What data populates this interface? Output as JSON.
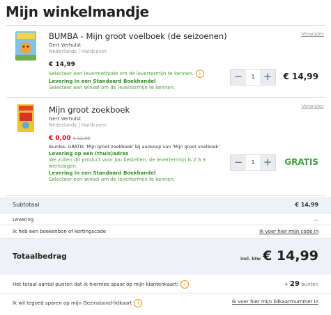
{
  "page": {
    "title": "Mijn winkelmandje"
  },
  "items": [
    {
      "name": "BUMBA - Mijn groot voelboek (de seizoenen)",
      "author": "Gert Verhulst",
      "meta": "Nederlands | Hardcover",
      "price": "€ 14,99",
      "delivery_hint": "Selecteer een levermethode om de levertermijn te kennen.",
      "delivery_store": "Levering in een Standaard Boekhandel",
      "store_hint": "Selecteer een winkel om de levertermijn te kennen.",
      "remove_label": "Verwijder",
      "qty": "1",
      "minus": "−",
      "plus": "+",
      "total": "€ 14,99"
    },
    {
      "name": "Mijn groot zoekboek",
      "author": "Gert Verhulst",
      "meta": "Nederlands | Hardcover",
      "price": "€ 0,00",
      "old_price": "€ 12,99",
      "promo_note": "Bumba: GRATIS 'Mijn groot zoekboek' bij aankoop van 'Mijn groot voelboek'",
      "delivery_home": "Levering op een (thuis)adres",
      "delivery_home_note": "We zullen dit product voor jou bestellen, de levertermijn is 2 à 3 werkdagen.",
      "delivery_store": "Levering in een Standaard Boekhandel",
      "store_hint": "Selecteer een winkel om de levertermijn te kennen.",
      "remove_label": "Verwijder",
      "qty": "1",
      "minus": "−",
      "plus": "+",
      "total": "GRATIS"
    }
  ],
  "summary": {
    "subtotal_label": "Subtotaal",
    "subtotal_value": "€ 14,99",
    "delivery_label": "Levering",
    "delivery_value": "—",
    "voucher_label": "Ik heb een boekenbon of kortingscode",
    "voucher_link": "Ik voer hier mijn code in",
    "total_label": "Totaalbedrag",
    "total_btw": "incl. btw",
    "total_value": "€ 14,99",
    "points_label": "Het totaal aantal punten dat ik hiermee spaar op mijn klantenkaart:",
    "points_prefix": "+ ",
    "points_value": "29",
    "points_unit": " punten",
    "gezinsbond_label": "Ik wil tegoed sparen op mijn Gezinsbond-lidkaart",
    "gezinsbond_link": "Ik voer hier mijn lidkaartnummer in"
  },
  "icons": {
    "info": "info-icon",
    "minus": "minus-icon",
    "plus": "plus-icon",
    "book_cover": "book-cover-image"
  },
  "colors": {
    "green": "#4aa03a",
    "price_red": "#d0021b",
    "info_orange": "#e39a1a",
    "summary_bg": "#eef1f5"
  }
}
